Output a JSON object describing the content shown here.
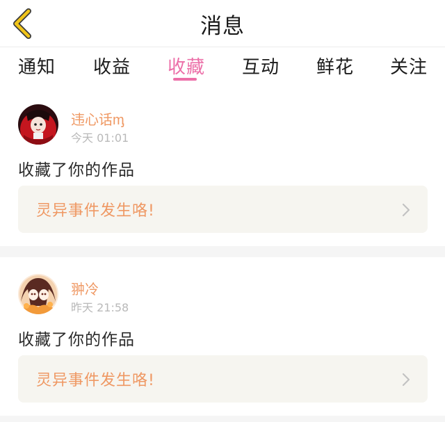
{
  "header": {
    "title": "消息",
    "back_icon": "chevron-left-icon"
  },
  "tabs": [
    {
      "label": "通知"
    },
    {
      "label": "收益"
    },
    {
      "label": "收藏",
      "active": true
    },
    {
      "label": "互动"
    },
    {
      "label": "鲜花"
    },
    {
      "label": "关注"
    }
  ],
  "colors": {
    "accent": "#ec6fa8",
    "name": "#ef9863",
    "back_icon": "#f0c419"
  },
  "notifications": [
    {
      "user": "违心话ᶆ",
      "time": "今天 01:01",
      "action": "收藏了你的作品",
      "work_title": "灵异事件发生咯!"
    },
    {
      "user": "翀冷",
      "time": "昨天 21:58",
      "action": "收藏了你的作品",
      "work_title": "灵异事件发生咯!"
    }
  ]
}
